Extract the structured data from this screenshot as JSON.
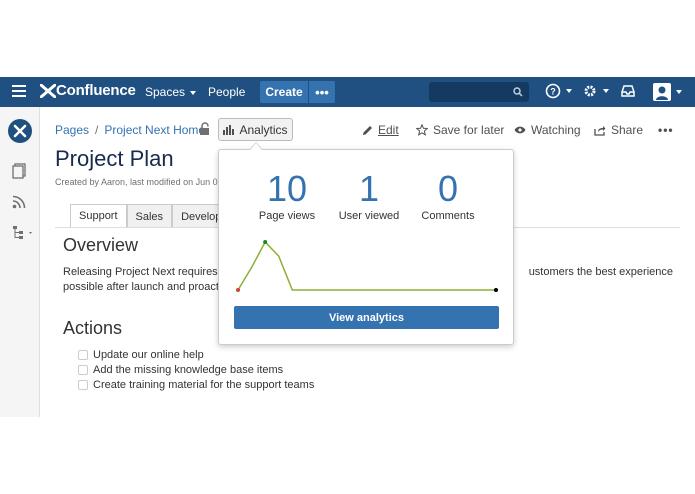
{
  "nav": {
    "logo": "Confluence",
    "spaces": "Spaces",
    "people": "People",
    "create": "Create",
    "more": "•••"
  },
  "breadcrumb": {
    "pages": "Pages",
    "sep": "/",
    "parent": "Project Next Home"
  },
  "toolbar": {
    "analytics": "Analytics",
    "edit": "Edit",
    "save_for_later": "Save for later",
    "watching": "Watching",
    "share": "Share",
    "more": "•••"
  },
  "page": {
    "title": "Project Plan",
    "byline": "Created by Aaron, last modified on Jun 0",
    "tabs": [
      "Support",
      "Sales",
      "Developm"
    ],
    "overview_heading": "Overview",
    "overview_text_1": "Releasing Project Next requires a",
    "overview_text_1b": "ustomers the best experience",
    "overview_text_2": "possible after launch and proactiv",
    "actions_heading": "Actions",
    "tasks": [
      "Update our online help",
      "Add the missing knowledge base items",
      "Create training material for the support teams"
    ]
  },
  "analytics_popup": {
    "stats": [
      {
        "value": "10",
        "label": "Page views"
      },
      {
        "value": "1",
        "label": "User viewed"
      },
      {
        "value": "0",
        "label": "Comments"
      }
    ],
    "button": "View analytics"
  },
  "chart_data": {
    "type": "line",
    "series": [
      {
        "values": [
          0,
          4,
          8.5,
          6,
          0,
          0,
          0,
          0,
          0,
          0,
          0,
          0,
          0,
          0,
          0,
          0,
          0,
          0,
          0,
          0
        ]
      }
    ],
    "colors": {
      "line": "#8cb033",
      "start_point": "#d04437",
      "peak_point": "#14892c",
      "end_point": "#000000"
    }
  },
  "colors": {
    "nav_bg": "#205081",
    "accent": "#3572b0"
  }
}
